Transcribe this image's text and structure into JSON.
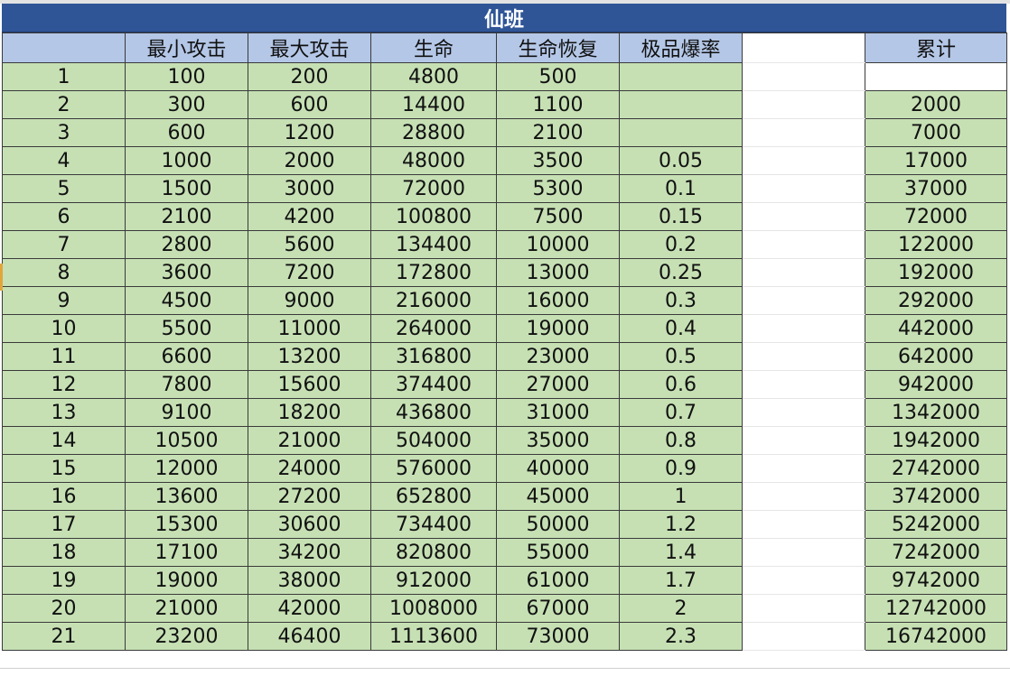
{
  "sheet": {
    "title": "仙班",
    "headers": [
      "",
      "最小攻击",
      "最大攻击",
      "生命",
      "生命恢复",
      "极品爆率",
      "",
      "累计"
    ],
    "rows": [
      [
        "1",
        "100",
        "200",
        "4800",
        "500",
        "",
        "",
        ""
      ],
      [
        "2",
        "300",
        "600",
        "14400",
        "1100",
        "",
        "",
        "2000"
      ],
      [
        "3",
        "600",
        "1200",
        "28800",
        "2100",
        "",
        "",
        "7000"
      ],
      [
        "4",
        "1000",
        "2000",
        "48000",
        "3500",
        "0.05",
        "",
        "17000"
      ],
      [
        "5",
        "1500",
        "3000",
        "72000",
        "5300",
        "0.1",
        "",
        "37000"
      ],
      [
        "6",
        "2100",
        "4200",
        "100800",
        "7500",
        "0.15",
        "",
        "72000"
      ],
      [
        "7",
        "2800",
        "5600",
        "134400",
        "10000",
        "0.2",
        "",
        "122000"
      ],
      [
        "8",
        "3600",
        "7200",
        "172800",
        "13000",
        "0.25",
        "",
        "192000"
      ],
      [
        "9",
        "4500",
        "9000",
        "216000",
        "16000",
        "0.3",
        "",
        "292000"
      ],
      [
        "10",
        "5500",
        "11000",
        "264000",
        "19000",
        "0.4",
        "",
        "442000"
      ],
      [
        "11",
        "6600",
        "13200",
        "316800",
        "23000",
        "0.5",
        "",
        "642000"
      ],
      [
        "12",
        "7800",
        "15600",
        "374400",
        "27000",
        "0.6",
        "",
        "942000"
      ],
      [
        "13",
        "9100",
        "18200",
        "436800",
        "31000",
        "0.7",
        "",
        "1342000"
      ],
      [
        "14",
        "10500",
        "21000",
        "504000",
        "35000",
        "0.8",
        "",
        "1942000"
      ],
      [
        "15",
        "12000",
        "24000",
        "576000",
        "40000",
        "0.9",
        "",
        "2742000"
      ],
      [
        "16",
        "13600",
        "27200",
        "652800",
        "45000",
        "1",
        "",
        "3742000"
      ],
      [
        "17",
        "15300",
        "30600",
        "734400",
        "50000",
        "1.2",
        "",
        "5242000"
      ],
      [
        "18",
        "17100",
        "34200",
        "820800",
        "55000",
        "1.4",
        "",
        "7242000"
      ],
      [
        "19",
        "19000",
        "38000",
        "912000",
        "61000",
        "1.7",
        "",
        "9742000"
      ],
      [
        "20",
        "21000",
        "42000",
        "1008000",
        "67000",
        "2",
        "",
        "12742000"
      ],
      [
        "21",
        "23200",
        "46400",
        "1113600",
        "73000",
        "2.3",
        "",
        "16742000"
      ]
    ]
  },
  "colors": {
    "title_bg": "#2f5597",
    "header_bg": "#b4c7e7",
    "data_bg": "#c6e0b4",
    "border": "#3a3a3a"
  }
}
